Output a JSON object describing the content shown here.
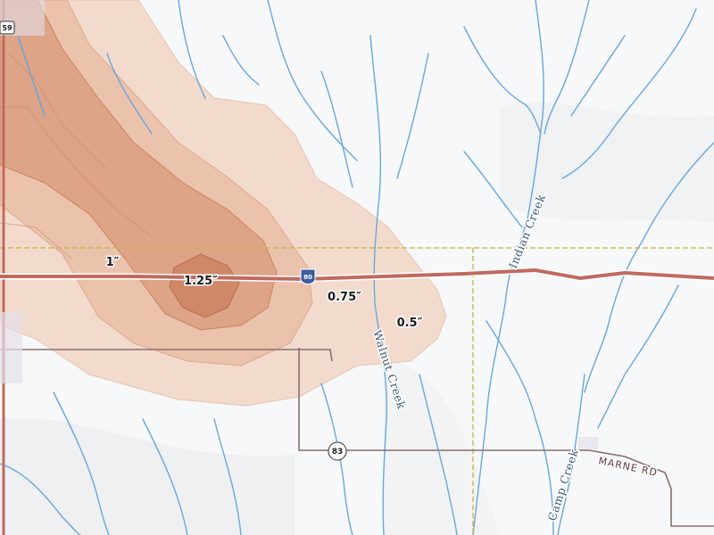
{
  "contours": [
    {
      "label": "0.5″",
      "value": 0.5,
      "color": "#f1d6c6"
    },
    {
      "label": "0.75″",
      "value": 0.75,
      "color": "#e8bda4"
    },
    {
      "label": "1″",
      "value": 1.0,
      "color": "#d99c7e"
    },
    {
      "label": "1.25″",
      "value": 1.25,
      "color": "#c9805f"
    }
  ],
  "labels": {
    "contour_05": "0.5″",
    "contour_075": "0.75″",
    "contour_1": "1″",
    "contour_125": "1.25″"
  },
  "creeks": {
    "indian": "Indian Creek",
    "walnut": "Walnut Creek",
    "camp": "Camp Creek"
  },
  "roads": {
    "interstate": "80",
    "highway": "83",
    "highway_nw": "59",
    "marne": "MARNE RD"
  },
  "colors": {
    "background": "#f6f7f8",
    "water": "#6aa6dc",
    "interstate": "#c06a60",
    "county_line": "#c9b33a",
    "road": "#8a6f6f"
  }
}
